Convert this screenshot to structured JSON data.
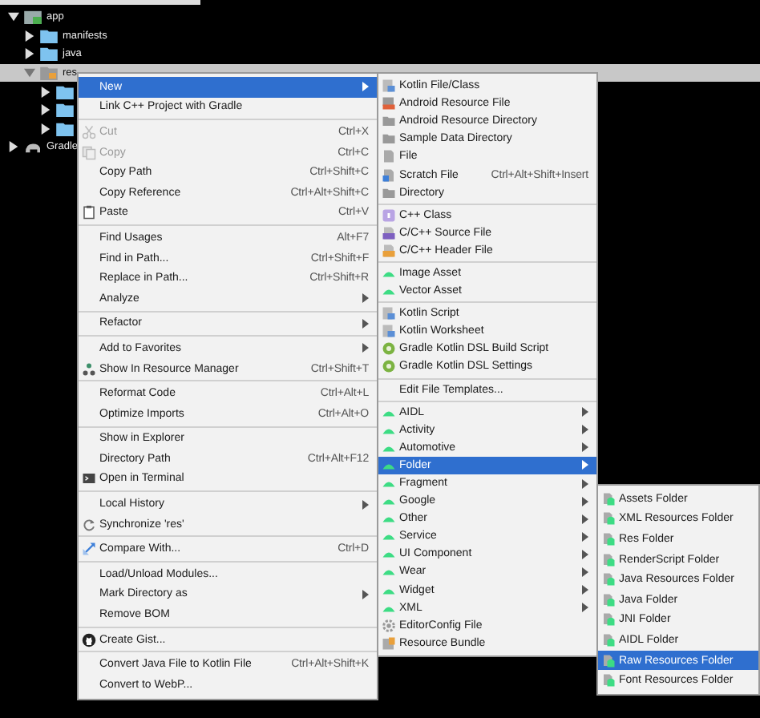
{
  "tree": [
    {
      "label": "app",
      "kind": "module",
      "expanded": true,
      "selected": false,
      "children": [
        {
          "label": "manifests",
          "kind": "folder",
          "expanded": false,
          "selected": false
        },
        {
          "label": "java",
          "kind": "folder",
          "expanded": false,
          "selected": false
        },
        {
          "label": "res",
          "kind": "resfolder",
          "expanded": true,
          "selected": true,
          "children": [
            {
              "kind": "folder",
              "expanded": false,
              "selected": false
            },
            {
              "kind": "folder",
              "expanded": false,
              "selected": false
            },
            {
              "kind": "folder",
              "expanded": false,
              "selected": false
            }
          ]
        }
      ]
    },
    {
      "label": "Gradle",
      "kind": "gradle",
      "expanded": false,
      "selected": false
    }
  ],
  "context_menu": {
    "items": [
      {
        "kind": "item",
        "label": "New",
        "submenu": true,
        "disabled": false,
        "selected": true
      },
      {
        "kind": "item",
        "label": "Link C++ Project with Gradle",
        "submenu": false,
        "disabled": false,
        "selected": false
      },
      {
        "kind": "separator"
      },
      {
        "kind": "item",
        "label": "Cut",
        "shortcut": "Ctrl+X",
        "submenu": false,
        "disabled": true,
        "selected": false
      },
      {
        "kind": "item",
        "label": "Copy",
        "shortcut": "Ctrl+C",
        "submenu": false,
        "disabled": true,
        "selected": false
      },
      {
        "kind": "item",
        "label": "Copy Path",
        "shortcut": "Ctrl+Shift+C",
        "submenu": false,
        "disabled": false,
        "selected": false
      },
      {
        "kind": "item",
        "label": "Copy Reference",
        "shortcut": "Ctrl+Alt+Shift+C",
        "submenu": false,
        "disabled": false,
        "selected": false
      },
      {
        "kind": "item",
        "label": "Paste",
        "shortcut": "Ctrl+V",
        "submenu": false,
        "disabled": false,
        "selected": false
      },
      {
        "kind": "separator"
      },
      {
        "kind": "item",
        "label": "Find Usages",
        "shortcut": "Alt+F7",
        "submenu": false,
        "disabled": false,
        "selected": false
      },
      {
        "kind": "item",
        "label": "Find in Path...",
        "shortcut": "Ctrl+Shift+F",
        "submenu": false,
        "disabled": false,
        "selected": false
      },
      {
        "kind": "item",
        "label": "Replace in Path...",
        "shortcut": "Ctrl+Shift+R",
        "submenu": false,
        "disabled": false,
        "selected": false
      },
      {
        "kind": "item",
        "label": "Analyze",
        "submenu": true,
        "disabled": false,
        "selected": false
      },
      {
        "kind": "separator"
      },
      {
        "kind": "item",
        "label": "Refactor",
        "submenu": true,
        "disabled": false,
        "selected": false
      },
      {
        "kind": "separator"
      },
      {
        "kind": "item",
        "label": "Add to Favorites",
        "submenu": true,
        "disabled": false,
        "selected": false
      },
      {
        "kind": "item",
        "label": "Show In Resource Manager",
        "shortcut": "Ctrl+Shift+T",
        "submenu": false,
        "disabled": false,
        "selected": false
      },
      {
        "kind": "separator"
      },
      {
        "kind": "item",
        "label": "Reformat Code",
        "shortcut": "Ctrl+Alt+L",
        "submenu": false,
        "disabled": false,
        "selected": false
      },
      {
        "kind": "item",
        "label": "Optimize Imports",
        "shortcut": "Ctrl+Alt+O",
        "submenu": false,
        "disabled": false,
        "selected": false
      },
      {
        "kind": "separator"
      },
      {
        "kind": "item",
        "label": "Show in Explorer",
        "submenu": false,
        "disabled": false,
        "selected": false
      },
      {
        "kind": "item",
        "label": "Directory Path",
        "shortcut": "Ctrl+Alt+F12",
        "submenu": false,
        "disabled": false,
        "selected": false
      },
      {
        "kind": "item",
        "label": "Open in Terminal",
        "submenu": false,
        "disabled": false,
        "selected": false
      },
      {
        "kind": "separator"
      },
      {
        "kind": "item",
        "label": "Local History",
        "submenu": true,
        "disabled": false,
        "selected": false
      },
      {
        "kind": "item",
        "label": "Synchronize 'res'",
        "submenu": false,
        "disabled": false,
        "selected": false
      },
      {
        "kind": "separator"
      },
      {
        "kind": "item",
        "label": "Compare With...",
        "shortcut": "Ctrl+D",
        "submenu": false,
        "disabled": false,
        "selected": false
      },
      {
        "kind": "separator"
      },
      {
        "kind": "item",
        "label": "Load/Unload Modules...",
        "submenu": false,
        "disabled": false,
        "selected": false
      },
      {
        "kind": "item",
        "label": "Mark Directory as",
        "submenu": true,
        "disabled": false,
        "selected": false
      },
      {
        "kind": "item",
        "label": "Remove BOM",
        "submenu": false,
        "disabled": false,
        "selected": false
      },
      {
        "kind": "separator"
      },
      {
        "kind": "item",
        "label": "Create Gist...",
        "submenu": false,
        "disabled": false,
        "selected": false
      },
      {
        "kind": "separator"
      },
      {
        "kind": "item",
        "label": "Convert Java File to Kotlin File",
        "shortcut": "Ctrl+Alt+Shift+K",
        "submenu": false,
        "disabled": false,
        "selected": false
      },
      {
        "kind": "item",
        "label": "Convert to WebP...",
        "submenu": false,
        "disabled": false,
        "selected": false
      }
    ]
  },
  "new_submenu": {
    "items": [
      {
        "kind": "item",
        "label": "Kotlin File/Class",
        "submenu": false,
        "selected": false
      },
      {
        "kind": "item",
        "label": "Android Resource File",
        "submenu": false,
        "selected": false
      },
      {
        "kind": "item",
        "label": "Android Resource Directory",
        "submenu": false,
        "selected": false
      },
      {
        "kind": "item",
        "label": "Sample Data Directory",
        "submenu": false,
        "selected": false
      },
      {
        "kind": "item",
        "label": "File",
        "submenu": false,
        "selected": false
      },
      {
        "kind": "item",
        "label": "Scratch File",
        "shortcut": "Ctrl+Alt+Shift+Insert",
        "submenu": false,
        "selected": false
      },
      {
        "kind": "item",
        "label": "Directory",
        "submenu": false,
        "selected": false
      },
      {
        "kind": "separator"
      },
      {
        "kind": "item",
        "label": "C++ Class",
        "submenu": false,
        "selected": false
      },
      {
        "kind": "item",
        "label": "C/C++ Source File",
        "submenu": false,
        "selected": false
      },
      {
        "kind": "item",
        "label": "C/C++ Header File",
        "submenu": false,
        "selected": false
      },
      {
        "kind": "separator"
      },
      {
        "kind": "item",
        "label": "Image Asset",
        "submenu": false,
        "selected": false
      },
      {
        "kind": "item",
        "label": "Vector Asset",
        "submenu": false,
        "selected": false
      },
      {
        "kind": "separator"
      },
      {
        "kind": "item",
        "label": "Kotlin Script",
        "submenu": false,
        "selected": false
      },
      {
        "kind": "item",
        "label": "Kotlin Worksheet",
        "submenu": false,
        "selected": false
      },
      {
        "kind": "item",
        "label": "Gradle Kotlin DSL Build Script",
        "submenu": false,
        "selected": false
      },
      {
        "kind": "item",
        "label": "Gradle Kotlin DSL Settings",
        "submenu": false,
        "selected": false
      },
      {
        "kind": "separator"
      },
      {
        "kind": "item",
        "label": "Edit File Templates...",
        "submenu": false,
        "selected": false
      },
      {
        "kind": "separator"
      },
      {
        "kind": "item",
        "label": "AIDL",
        "submenu": true,
        "selected": false
      },
      {
        "kind": "item",
        "label": "Activity",
        "submenu": true,
        "selected": false
      },
      {
        "kind": "item",
        "label": "Automotive",
        "submenu": true,
        "selected": false
      },
      {
        "kind": "item",
        "label": "Folder",
        "submenu": true,
        "selected": true
      },
      {
        "kind": "item",
        "label": "Fragment",
        "submenu": true,
        "selected": false
      },
      {
        "kind": "item",
        "label": "Google",
        "submenu": true,
        "selected": false
      },
      {
        "kind": "item",
        "label": "Other",
        "submenu": true,
        "selected": false
      },
      {
        "kind": "item",
        "label": "Service",
        "submenu": true,
        "selected": false
      },
      {
        "kind": "item",
        "label": "UI Component",
        "submenu": true,
        "selected": false
      },
      {
        "kind": "item",
        "label": "Wear",
        "submenu": true,
        "selected": false
      },
      {
        "kind": "item",
        "label": "Widget",
        "submenu": true,
        "selected": false
      },
      {
        "kind": "item",
        "label": "XML",
        "submenu": true,
        "selected": false
      },
      {
        "kind": "item",
        "label": "EditorConfig File",
        "submenu": false,
        "selected": false
      },
      {
        "kind": "item",
        "label": "Resource Bundle",
        "submenu": false,
        "selected": false
      }
    ]
  },
  "folder_submenu": {
    "items": [
      {
        "kind": "item",
        "label": "Assets Folder",
        "selected": false
      },
      {
        "kind": "item",
        "label": "XML Resources Folder",
        "selected": false
      },
      {
        "kind": "item",
        "label": "Res Folder",
        "selected": false
      },
      {
        "kind": "item",
        "label": "RenderScript Folder",
        "selected": false
      },
      {
        "kind": "item",
        "label": "Java Resources Folder",
        "selected": false
      },
      {
        "kind": "item",
        "label": "Java Folder",
        "selected": false
      },
      {
        "kind": "item",
        "label": "JNI Folder",
        "selected": false
      },
      {
        "kind": "item",
        "label": "AIDL Folder",
        "selected": false
      },
      {
        "kind": "item",
        "label": "Raw Resources Folder",
        "selected": true
      },
      {
        "kind": "item",
        "label": "Font Resources Folder",
        "selected": false
      }
    ]
  }
}
